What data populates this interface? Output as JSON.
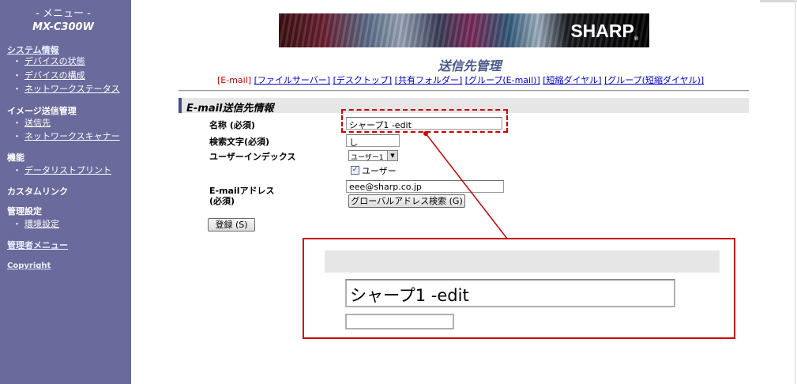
{
  "sidebar": {
    "menu_title": "- メニュー -",
    "model": "MX-C300W",
    "sections": [
      {
        "label": "システム情報",
        "items": [
          "デバイスの状態",
          "デバイスの構成",
          "ネットワークステータス"
        ]
      },
      {
        "label": "イメージ送信管理",
        "items": [
          "送信先",
          "ネットワークスキャナー"
        ]
      },
      {
        "label": "機能",
        "items": [
          "データリストプリント"
        ]
      },
      {
        "label": "カスタムリンク",
        "items": []
      },
      {
        "label": "管理設定",
        "items": [
          "環境設定"
        ]
      },
      {
        "label": "管理者メニュー",
        "items": []
      },
      {
        "label": "Copyright",
        "items": []
      }
    ],
    "bullet": "・"
  },
  "banner": {
    "logo": "SHARP",
    "reg": "®"
  },
  "page_title": "送信先管理",
  "tabs": [
    "[E-mail]",
    "[ファイルサーバー]",
    "[デスクトップ]",
    "[共有フォルダー]",
    "[グループ(E-mail)]",
    "[短縮ダイヤル]",
    "[グループ(短縮ダイヤル)]"
  ],
  "section_title": "E-mail送信先情報",
  "form": {
    "name_label": "名称 (必須)",
    "name_value": "シャープ1 -edit",
    "search_label": "検索文字(必須)",
    "search_value": "し",
    "index_label": "ユーザーインデックス",
    "index_value": "ユーザー1",
    "user_checkbox_label": "ユーザー",
    "email_label_1": "E-mailアドレス",
    "email_label_2": "(必須)",
    "email_value": "eee@sharp.co.jp",
    "global_search_button": "グローバルアドレス検索 (G)",
    "register_button": "登録 (S)"
  },
  "zoom": {
    "name_value": "シャープ1 -edit"
  },
  "colors": {
    "sidebar": "#6a6a9c",
    "highlight": "#cc0000",
    "title": "#4a5a8c",
    "link": "#0000cc"
  }
}
